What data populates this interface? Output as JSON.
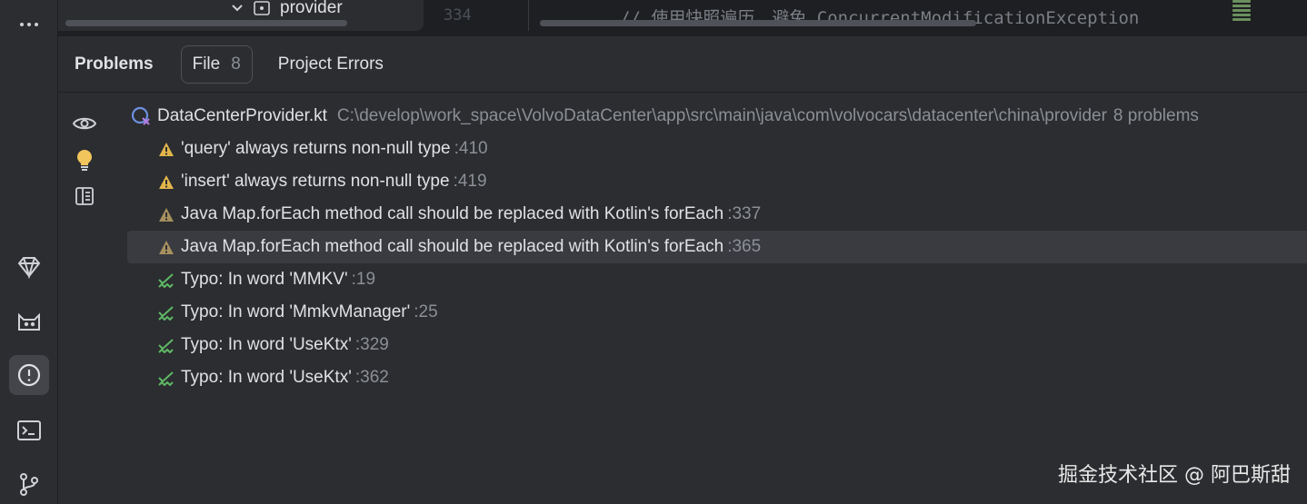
{
  "top": {
    "project_item": "provider",
    "line_number": "334",
    "code_text": "// 使用快照遍历，避免 ConcurrentModificationException"
  },
  "panel": {
    "title": "Problems",
    "tab_file_label": "File",
    "tab_file_count": "8",
    "tab_project_errors": "Project Errors"
  },
  "file": {
    "name": "DataCenterProvider.kt",
    "path": "C:\\develop\\work_space\\VolvoDataCenter\\app\\src\\main\\java\\com\\volvocars\\datacenter\\china\\provider",
    "count": "8 problems"
  },
  "problems": [
    {
      "icon": "warning-icon",
      "message": "'query' always returns non-null type",
      "line": ":410",
      "selected": false
    },
    {
      "icon": "warning-icon",
      "message": "'insert' always returns non-null type",
      "line": ":419",
      "selected": false
    },
    {
      "icon": "weak-warning-icon",
      "message": "Java Map.forEach method call should be replaced with Kotlin's forEach",
      "line": ":337",
      "selected": false
    },
    {
      "icon": "weak-warning-icon",
      "message": "Java Map.forEach method call should be replaced with Kotlin's forEach",
      "line": ":365",
      "selected": true
    },
    {
      "icon": "typo-icon",
      "message": "Typo: In word 'MMKV'",
      "line": ":19",
      "selected": false
    },
    {
      "icon": "typo-icon",
      "message": "Typo: In word 'MmkvManager'",
      "line": ":25",
      "selected": false
    },
    {
      "icon": "typo-icon",
      "message": "Typo: In word 'UseKtx'",
      "line": ":329",
      "selected": false
    },
    {
      "icon": "typo-icon",
      "message": "Typo: In word 'UseKtx'",
      "line": ":362",
      "selected": false
    }
  ],
  "watermark": "掘金技术社区 @ 阿巴斯甜",
  "colors": {
    "warning": "#e0b54a",
    "weak_warning": "#a6905e",
    "typo": "#5fb865",
    "bulb": "#f2c55c"
  }
}
